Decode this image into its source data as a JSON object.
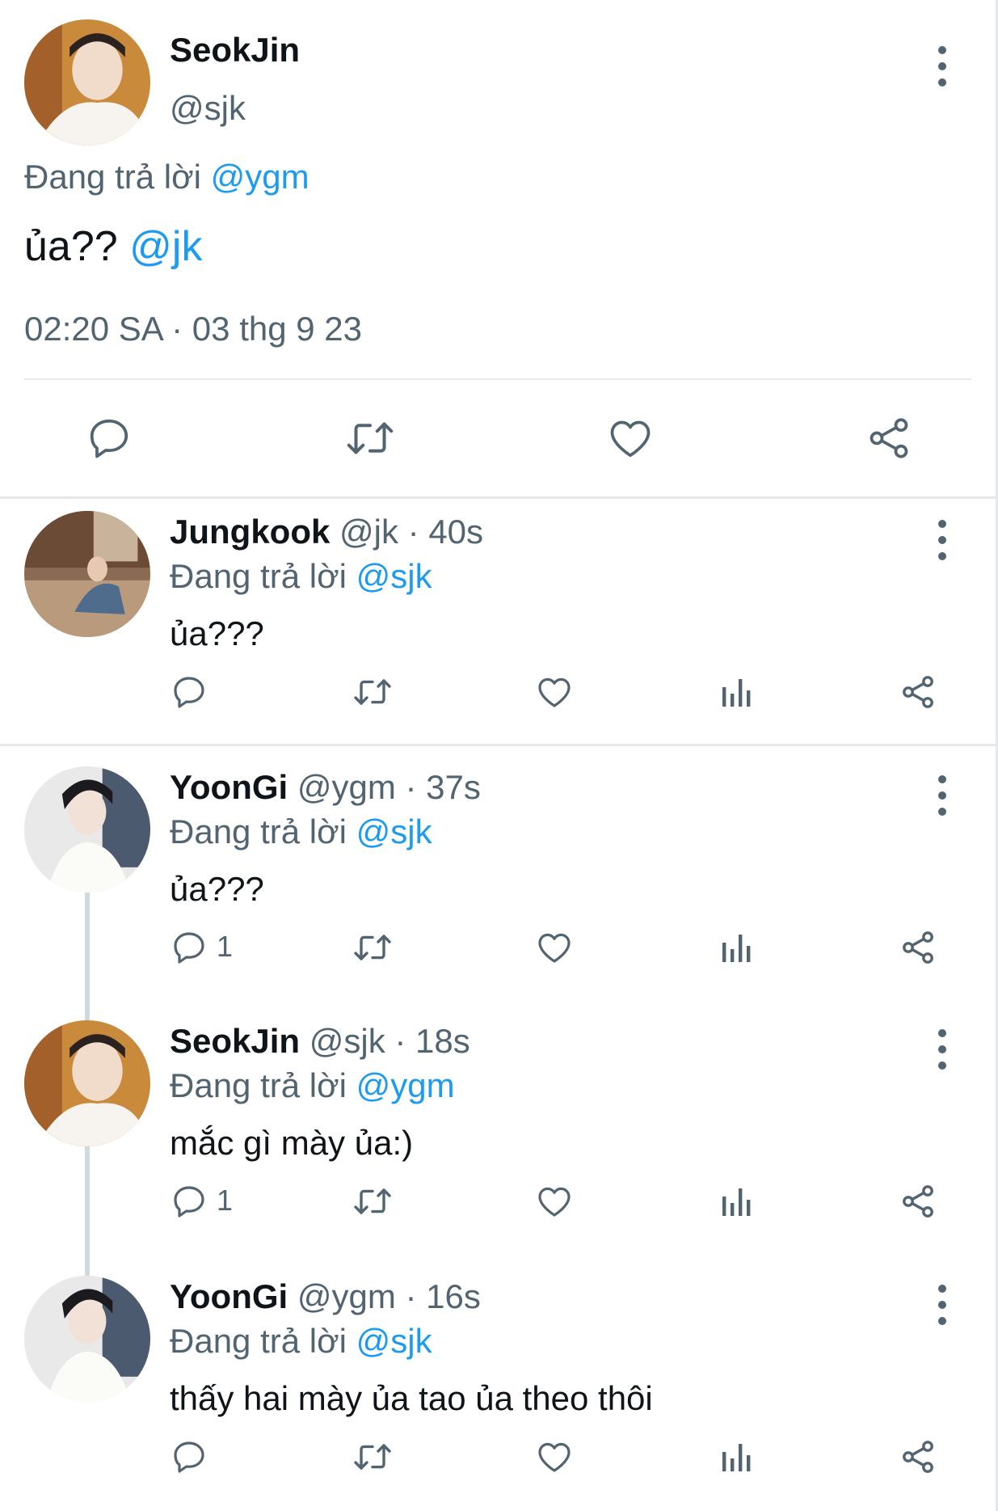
{
  "main_tweet": {
    "name": "SeokJin",
    "handle": "@sjk",
    "replying_prefix": "Đang trả lời ",
    "replying_to": "@ygm",
    "body_text": "ủa?? ",
    "body_mention": "@jk",
    "timestamp": "02:20 SA · 03 thg 9 23",
    "actions": [
      "reply-icon",
      "retweet-icon",
      "like-icon",
      "share-icon"
    ]
  },
  "replies": [
    {
      "name": "Jungkook",
      "meta": " @jk · 40s",
      "replying_prefix": "Đang trả lời ",
      "replying_to": "@sjk",
      "text": "ủa???",
      "reply_count": ""
    },
    {
      "name": "YoonGi",
      "meta": " @ygm · 37s",
      "replying_prefix": "Đang trả lời ",
      "replying_to": "@sjk",
      "text": "ủa???",
      "reply_count": "1"
    },
    {
      "name": "SeokJin",
      "meta": " @sjk · 18s",
      "replying_prefix": "Đang trả lời ",
      "replying_to": "@ygm",
      "text": "mắc gì mày ủa:)",
      "reply_count": "1"
    },
    {
      "name": "YoonGi",
      "meta": " @ygm · 16s",
      "replying_prefix": "Đang trả lời ",
      "replying_to": "@sjk",
      "text": "thấy hai mày ủa tao ủa theo thôi",
      "reply_count": ""
    }
  ],
  "colors": {
    "accent": "#1d9bf0",
    "secondary_text": "#536471",
    "primary_text": "#0f1419",
    "divider": "#e6e9ec"
  }
}
